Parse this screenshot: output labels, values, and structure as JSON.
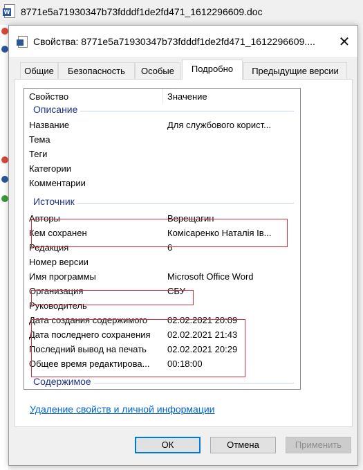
{
  "window": {
    "file_title": "8771e5a71930347b73fdddf1de2fd471_1612296609.doc"
  },
  "dialog": {
    "title": "Свойства: 8771e5a71930347b73fdddf1de2fd471_1612296609....",
    "close_glyph": "✕",
    "icon": "word-document-icon"
  },
  "tabs": [
    {
      "label": "Общие",
      "active": false
    },
    {
      "label": "Безопасность",
      "active": false
    },
    {
      "label": "Особые",
      "active": false
    },
    {
      "label": "Подробно",
      "active": true
    },
    {
      "label": "Предыдущие версии",
      "active": false
    }
  ],
  "list": {
    "col_property": "Свойство",
    "col_value": "Значение",
    "groups": {
      "description": "Описание",
      "source": "Источник",
      "content": "Содержимое"
    },
    "rows": [
      {
        "key": "Название",
        "value": "Для службового корист..."
      },
      {
        "key": "Тема",
        "value": ""
      },
      {
        "key": "Теги",
        "value": ""
      },
      {
        "key": "Категории",
        "value": ""
      },
      {
        "key": "Комментарии",
        "value": ""
      },
      {
        "key": "Авторы",
        "value": "Верещагин"
      },
      {
        "key": "Кем сохранен",
        "value": "Комісаренко Наталія Ів..."
      },
      {
        "key": "Редакция",
        "value": "6"
      },
      {
        "key": "Номер версии",
        "value": ""
      },
      {
        "key": "Имя программы",
        "value": "Microsoft Office Word"
      },
      {
        "key": "Организация",
        "value": "СБУ"
      },
      {
        "key": "Руководитель",
        "value": ""
      },
      {
        "key": "Дата создания содержимого",
        "value": "02.02.2021 20:09"
      },
      {
        "key": "Дата последнего сохранения",
        "value": "02.02.2021 21:43"
      },
      {
        "key": "Последний вывод на печать",
        "value": "02.02.2021 20:29"
      },
      {
        "key": "Общее время редактирова...",
        "value": "00:18:00"
      }
    ],
    "scroll_up_glyph": "▲",
    "scroll_down_glyph": "▼"
  },
  "link_text": "Удаление свойств и личной информации",
  "buttons": {
    "ok": "ОК",
    "cancel": "Отмена",
    "apply": "Применить"
  },
  "colors": {
    "highlight": "#d1303a",
    "group_text": "#1e3287",
    "link": "#0066cc",
    "default_button_border": "#0078d7"
  }
}
